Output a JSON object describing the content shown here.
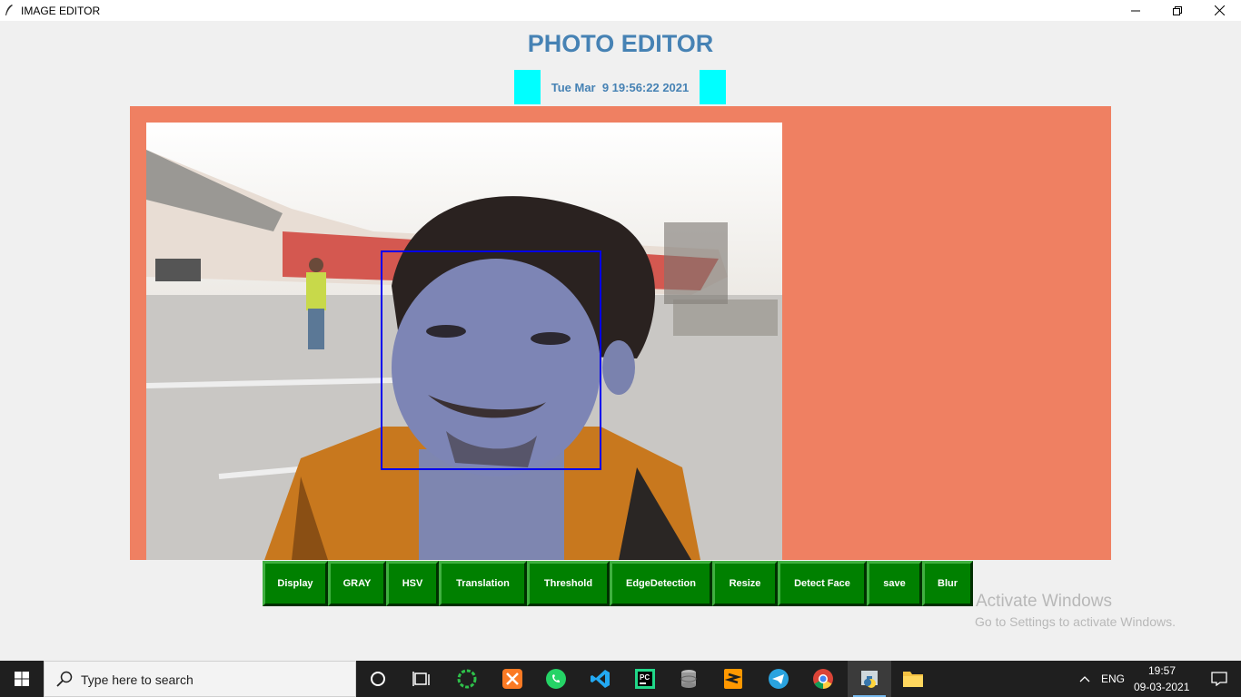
{
  "window": {
    "title": "IMAGE EDITOR"
  },
  "header": {
    "title": "PHOTO EDITOR",
    "datetime": "Tue Mar  9 19:56:22 2021"
  },
  "colors": {
    "accent": "#4682b4",
    "canvas": "#ef8062",
    "clock_marker": "#00ffff",
    "button": "#008000",
    "face_box": "#0000ee"
  },
  "toolbar": {
    "buttons": [
      {
        "label": "Display"
      },
      {
        "label": "GRAY"
      },
      {
        "label": "HSV"
      },
      {
        "label": "Translation"
      },
      {
        "label": "Threshold"
      },
      {
        "label": "EdgeDetection"
      },
      {
        "label": "Resize"
      },
      {
        "label": "Detect Face"
      },
      {
        "label": "save"
      },
      {
        "label": "Blur"
      }
    ]
  },
  "watermark": {
    "line1": "Activate Windows",
    "line2": "Go to Settings to activate Windows."
  },
  "taskbar": {
    "search_placeholder": "Type here to search",
    "apps": [
      "cortana-icon",
      "task-view-icon",
      "loader-icon",
      "xampp-icon",
      "whatsapp-icon",
      "vscode-icon",
      "pycharm-icon",
      "database-icon",
      "sublime-icon",
      "telegram-icon",
      "chrome-icon",
      "python-icon",
      "file-explorer-icon"
    ],
    "language": "ENG",
    "time": "19:57",
    "date": "09-03-2021"
  }
}
